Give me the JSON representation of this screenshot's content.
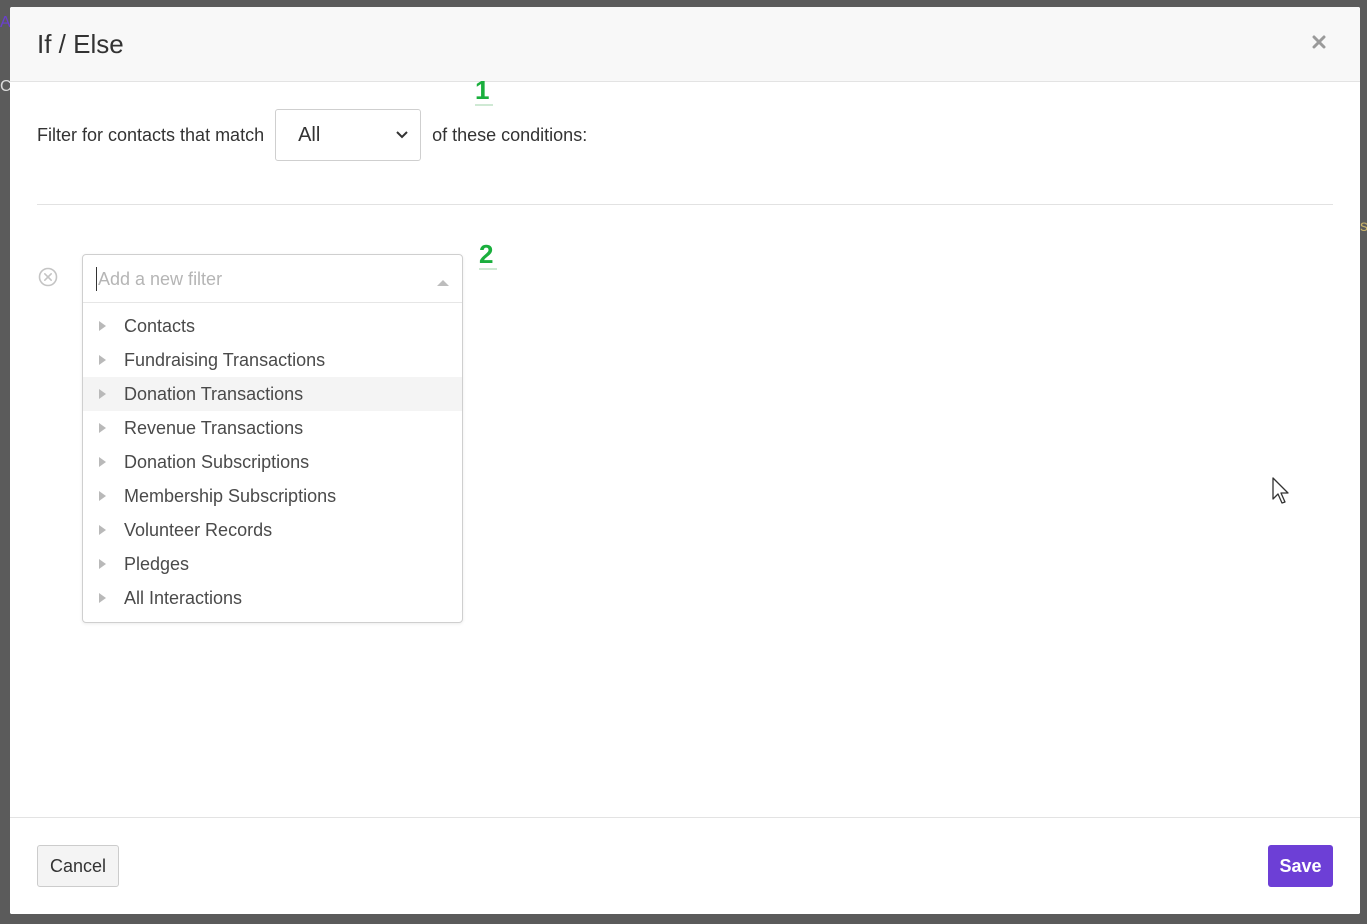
{
  "background": {
    "fragment_a": "A",
    "fragment_c": "C",
    "fragment_s": "s"
  },
  "modal": {
    "title": "If / Else",
    "close_icon": "close-icon"
  },
  "condition": {
    "prefix": "Filter for contacts that match",
    "match_value": "All",
    "suffix": "of these conditions:"
  },
  "markers": [
    "1",
    "2"
  ],
  "filter": {
    "placeholder": "Add a new filter",
    "value": "",
    "options": [
      "Contacts",
      "Fundraising Transactions",
      "Donation Transactions",
      "Revenue Transactions",
      "Donation Subscriptions",
      "Membership Subscriptions",
      "Volunteer Records",
      "Pledges",
      "All Interactions"
    ],
    "highlighted": "Donation Transactions"
  },
  "footer": {
    "cancel_label": "Cancel",
    "save_label": "Save"
  },
  "colors": {
    "accent": "#6d3fd6",
    "marker": "#1aaf3d",
    "overlay": "#5b5b5b"
  }
}
